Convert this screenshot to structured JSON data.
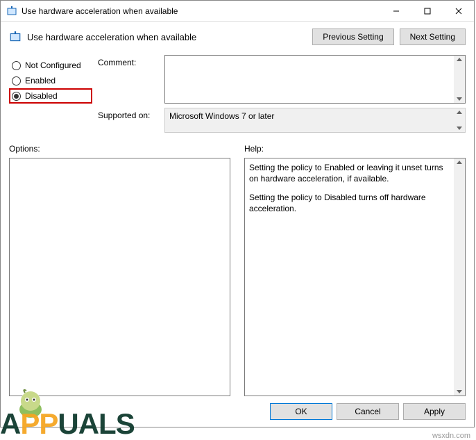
{
  "titlebar": {
    "title": "Use hardware acceleration when available"
  },
  "header": {
    "policy_title": "Use hardware acceleration when available",
    "prev_button": "Previous Setting",
    "next_button": "Next Setting"
  },
  "radio": {
    "not_configured": "Not Configured",
    "enabled": "Enabled",
    "disabled": "Disabled"
  },
  "form": {
    "comment_label": "Comment:",
    "comment_value": "",
    "supported_label": "Supported on:",
    "supported_value": "Microsoft Windows 7 or later"
  },
  "lower": {
    "options_label": "Options:",
    "options_value": "",
    "help_label": "Help:",
    "help_p1": "Setting the policy to Enabled or leaving it unset turns on hardware acceleration, if available.",
    "help_p2": "Setting the policy to Disabled turns off hardware acceleration."
  },
  "footer": {
    "ok": "OK",
    "cancel": "Cancel",
    "apply": "Apply"
  },
  "watermark": {
    "brand_pre": "A",
    "brand_mid": "PP",
    "brand_post": "UALS",
    "url": "wsxdn.com"
  }
}
